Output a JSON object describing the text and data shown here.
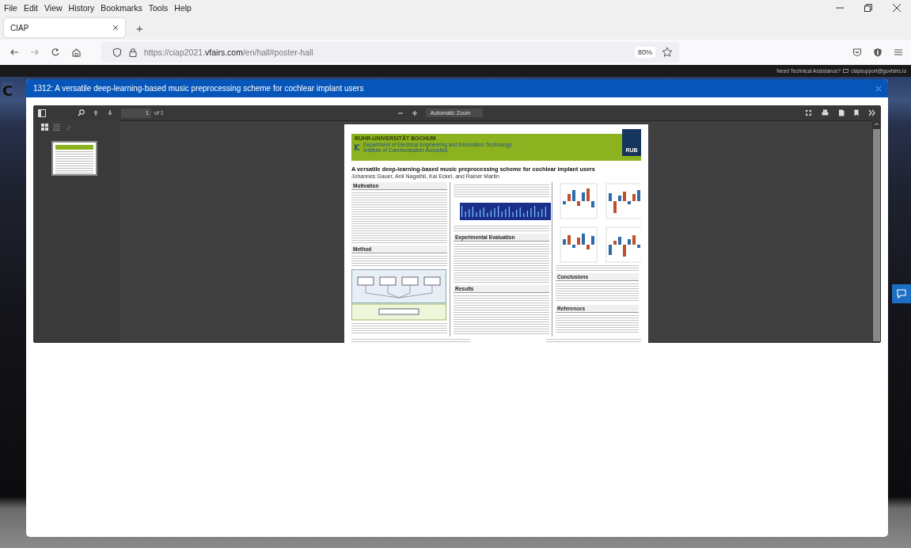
{
  "browser": {
    "menu": [
      "File",
      "Edit",
      "View",
      "History",
      "Bookmarks",
      "Tools",
      "Help"
    ],
    "tabs": [
      {
        "label": "CIAP",
        "selected": true
      }
    ],
    "new_tab": "+",
    "url": {
      "prefix": "https://ciap2021.",
      "domain": "vfairs.com",
      "path": "/en/hall#poster-hall"
    },
    "zoom": "80%"
  },
  "site": {
    "logo_letter": "C",
    "help_text": "Need Technical Assistance?",
    "support_email": "ciapsupport@govfairs.io"
  },
  "modal": {
    "title": "1312: A versatile deep-learning-based music preprocessing scheme for cochlear implant users",
    "viewer": {
      "page_number": "1",
      "page_count": "of 1",
      "zoom_mode": "Automatic Zoom",
      "poster": {
        "university": "RUHR-UNIVERSITÄT BOCHUM",
        "department": "Department of Electrical Engineering and Information Technology",
        "institute": "Institute of Communication Acoustics",
        "logo": "RUB",
        "title": "A versatile deep-learning-based music preprocessing scheme for cochlear implant users",
        "authors": "Johannes Gauer, Anil Nagathil, Kai Eckel, and Rainer Martin",
        "columns": [
          {
            "sections": [
              {
                "heading": "Motivation",
                "blocks": [
                  {
                    "kind": "text"
                  }
                ]
              },
              {
                "heading": "Method",
                "blocks": [
                  {
                    "kind": "text"
                  },
                  {
                    "kind": "diagram"
                  },
                  {
                    "kind": "text"
                  }
                ]
              }
            ]
          },
          {
            "sections": [
              {
                "blocks": [
                  {
                    "kind": "text"
                  },
                  {
                    "kind": "spectrogram"
                  },
                  {
                    "kind": "caption"
                  }
                ]
              },
              {
                "heading": "Experimental Evaluation",
                "blocks": [
                  {
                    "kind": "text"
                  }
                ]
              },
              {
                "heading": "Results",
                "blocks": [
                  {
                    "kind": "text"
                  }
                ]
              }
            ]
          },
          {
            "sections": [
              {
                "blocks": [
                  {
                    "kind": "bar_chart"
                  },
                  {
                    "kind": "caption"
                  }
                ]
              },
              {
                "heading": "Conclusions",
                "blocks": [
                  {
                    "kind": "text"
                  }
                ]
              },
              {
                "heading": "References",
                "blocks": [
                  {
                    "kind": "text"
                  }
                ]
              }
            ]
          }
        ]
      }
    }
  }
}
